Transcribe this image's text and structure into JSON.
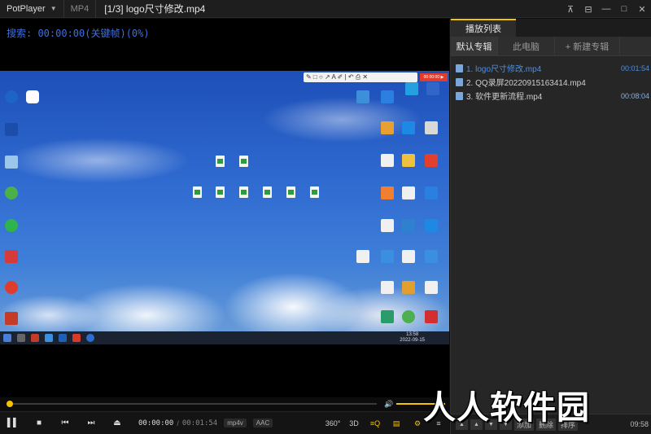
{
  "titlebar": {
    "app_name": "PotPlayer",
    "format": "MP4",
    "file_title": "[1/3] logo尺寸修改.mp4",
    "controls": [
      "⊼",
      "⊟",
      "—",
      "□",
      "✕"
    ]
  },
  "video": {
    "search_text": "搜索: 00:00:00(关键帧)(0%)",
    "taskbar_time": "13:58",
    "taskbar_date": "2022-09-15",
    "rec_badge": "00:00:00 ▶",
    "mini_toolbar": "✎ □ ○ ↗ A ✐ | ↶ ⎙ ✕"
  },
  "controls": {
    "time_current": "00:00:00",
    "time_separator": "/",
    "time_total": "00:01:54",
    "video_codec": "mp4v",
    "audio_codec": "AAC",
    "progress": 0.0,
    "volume": 1.0,
    "right_labels": [
      "360°",
      "3D",
      "≡Q",
      "▤",
      "⚙",
      "≡"
    ]
  },
  "playlist": {
    "title": "播放列表",
    "tabs": [
      "默认专辑",
      "此电脑",
      "+ 新建专辑"
    ],
    "items": [
      {
        "name": "1. logo尺寸修改.mp4",
        "duration": "00:01:54",
        "active": true
      },
      {
        "name": "2. QQ录屏20220915163414.mp4",
        "duration": "",
        "active": false
      },
      {
        "name": "3. 软件更新流程.mp4",
        "duration": "00:08:04",
        "active": false
      }
    ],
    "bottom": {
      "add": "添加",
      "delete": "删除",
      "sort": "排序",
      "time": "09:58"
    }
  },
  "watermark": "人人软件园",
  "colors": {
    "accent": "#f5c400",
    "active_item": "#4a90e6",
    "search_text": "#3f6fe0"
  }
}
